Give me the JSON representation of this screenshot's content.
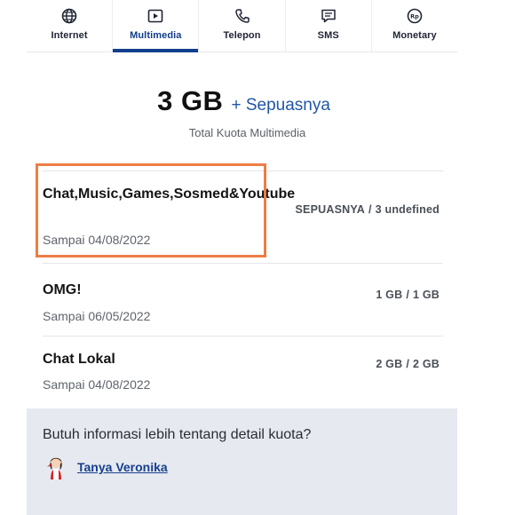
{
  "tabs": [
    {
      "label": "Internet",
      "icon": "globe-icon",
      "active": false
    },
    {
      "label": "Multimedia",
      "icon": "play-icon",
      "active": true
    },
    {
      "label": "Telepon",
      "icon": "phone-icon",
      "active": false
    },
    {
      "label": "SMS",
      "icon": "message-icon",
      "active": false
    },
    {
      "label": "Monetary",
      "icon": "rupiah-coin-icon",
      "active": false
    }
  ],
  "summary": {
    "amount": "3 GB",
    "extra": "+ Sepuasnya",
    "caption": "Total Kuota Multimedia"
  },
  "quotas": [
    {
      "name": "Chat,Music,Games,Sosmed&Youtube",
      "expiry": "Sampai 04/08/2022",
      "remaining": "SEPUASNYA",
      "separator": "/",
      "total": "3 undefined"
    },
    {
      "name": "OMG!",
      "expiry": "Sampai 06/05/2022",
      "remaining": "1 GB",
      "separator": "/",
      "total": "1 GB"
    },
    {
      "name": "Chat Lokal",
      "expiry": "Sampai 04/08/2022",
      "remaining": "2 GB",
      "separator": "/",
      "total": "2 GB"
    }
  ],
  "info": {
    "question": "Butuh informasi lebih tentang detail kuota?",
    "link": "Tanya Veronika",
    "avatar_icon": "veronika-avatar-icon"
  },
  "colors": {
    "accent": "#123e8d",
    "link": "#163f8e",
    "highlight": "#ee7d45",
    "info_bg": "#e6e9ef"
  }
}
